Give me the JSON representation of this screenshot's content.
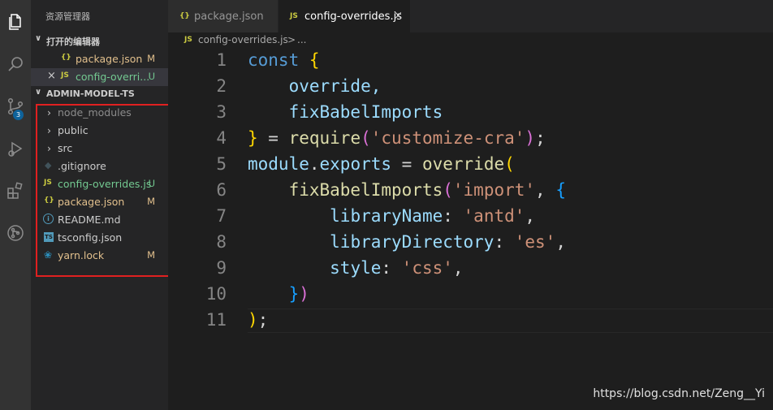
{
  "activity_bar": {
    "items": [
      {
        "icon": "files-icon",
        "active": true
      },
      {
        "icon": "search-icon"
      },
      {
        "icon": "source-control-icon",
        "badge": "3"
      },
      {
        "icon": "run-debug-icon"
      },
      {
        "icon": "extensions-icon"
      },
      {
        "icon": "remote-icon"
      }
    ]
  },
  "sidebar": {
    "title": "资源管理器",
    "open_editors_label": "打开的编辑器",
    "open_editors": [
      {
        "name": "package.json",
        "type": "json",
        "status": "M"
      },
      {
        "name": "config-overri...",
        "type": "js",
        "status": "U",
        "close": "×"
      }
    ],
    "project_label": "ADMIN-MODEL-TS",
    "tree": [
      {
        "name": "node_modules",
        "kind": "folder",
        "chevron": "›"
      },
      {
        "name": "public",
        "kind": "folder",
        "chevron": "›"
      },
      {
        "name": "src",
        "kind": "folder",
        "chevron": "›"
      },
      {
        "name": ".gitignore",
        "kind": "git"
      },
      {
        "name": "config-overrides.js",
        "kind": "js",
        "status": "U"
      },
      {
        "name": "package.json",
        "kind": "json",
        "status": "M"
      },
      {
        "name": "README.md",
        "kind": "info"
      },
      {
        "name": "tsconfig.json",
        "kind": "ts"
      },
      {
        "name": "yarn.lock",
        "kind": "yarn",
        "status": "M"
      }
    ]
  },
  "tabs": [
    {
      "label": "package.json",
      "icon": "{}",
      "active": false
    },
    {
      "label": "config-overrides.js",
      "icon": "JS",
      "active": true,
      "close": "×"
    }
  ],
  "breadcrumb": {
    "icon": "JS",
    "file": "config-overrides.js",
    "sep": ">",
    "rest": "..."
  },
  "code": {
    "line_numbers": [
      "1",
      "2",
      "3",
      "4",
      "5",
      "6",
      "7",
      "8",
      "9",
      "10",
      "11"
    ],
    "lines": [
      [
        {
          "t": "const ",
          "c": "kw"
        },
        {
          "t": "{",
          "c": "br1"
        }
      ],
      [
        {
          "t": "    override,",
          "c": "var"
        }
      ],
      [
        {
          "t": "    fixBabelImports",
          "c": "var"
        }
      ],
      [
        {
          "t": "}",
          "c": "br1"
        },
        {
          "t": " = ",
          "c": "plain"
        },
        {
          "t": "require",
          "c": "fn"
        },
        {
          "t": "(",
          "c": "br2"
        },
        {
          "t": "'customize-cra'",
          "c": "str"
        },
        {
          "t": ")",
          "c": "br2"
        },
        {
          "t": ";",
          "c": "plain"
        }
      ],
      [
        {
          "t": "module",
          "c": "var"
        },
        {
          "t": ".",
          "c": "plain"
        },
        {
          "t": "exports",
          "c": "var"
        },
        {
          "t": " = ",
          "c": "plain"
        },
        {
          "t": "override",
          "c": "fn"
        },
        {
          "t": "(",
          "c": "br1"
        }
      ],
      [
        {
          "t": "    ",
          "c": "plain"
        },
        {
          "t": "fixBabelImports",
          "c": "fn"
        },
        {
          "t": "(",
          "c": "br2"
        },
        {
          "t": "'import'",
          "c": "str"
        },
        {
          "t": ", ",
          "c": "plain"
        },
        {
          "t": "{",
          "c": "br3"
        }
      ],
      [
        {
          "t": "        ",
          "c": "plain"
        },
        {
          "t": "libraryName",
          "c": "var"
        },
        {
          "t": ": ",
          "c": "plain"
        },
        {
          "t": "'antd'",
          "c": "str"
        },
        {
          "t": ",",
          "c": "plain"
        }
      ],
      [
        {
          "t": "        ",
          "c": "plain"
        },
        {
          "t": "libraryDirectory",
          "c": "var"
        },
        {
          "t": ": ",
          "c": "plain"
        },
        {
          "t": "'es'",
          "c": "str"
        },
        {
          "t": ",",
          "c": "plain"
        }
      ],
      [
        {
          "t": "        ",
          "c": "plain"
        },
        {
          "t": "style",
          "c": "var"
        },
        {
          "t": ": ",
          "c": "plain"
        },
        {
          "t": "'css'",
          "c": "str"
        },
        {
          "t": ",",
          "c": "plain"
        }
      ],
      [
        {
          "t": "    ",
          "c": "plain"
        },
        {
          "t": "}",
          "c": "br3"
        },
        {
          "t": ")",
          "c": "br2"
        }
      ],
      [
        {
          "t": ")",
          "c": "br1"
        },
        {
          "t": ";",
          "c": "plain"
        }
      ]
    ]
  },
  "colors": {
    "kw": "#569cd6",
    "var": "#9cdcfe",
    "fn": "#dcdcaa",
    "str": "#ce9178",
    "plain": "#d4d4d4",
    "br1": "#ffd700",
    "br2": "#da70d6",
    "br3": "#179fff",
    "modified": "#e2c08d",
    "untracked": "#73c991",
    "js": "#cbcb41",
    "json": "#cbcb41",
    "ts": "#519aba",
    "git": "#41535b",
    "yarn": "#2c8ebb",
    "info": "#519aba"
  },
  "watermark": "https://blog.csdn.net/Zeng__Yi"
}
